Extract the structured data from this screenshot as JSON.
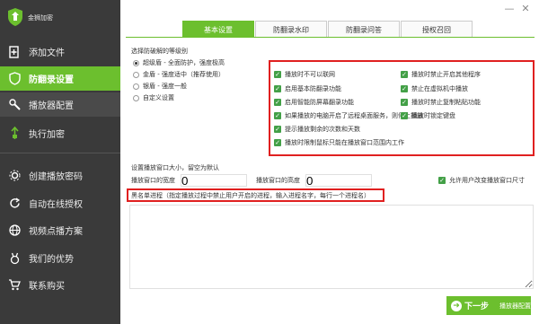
{
  "app": {
    "title": "金狮加密"
  },
  "sidebar": {
    "items": [
      {
        "label": "添加文件",
        "icon": "file-add-icon"
      },
      {
        "label": "防翻录设置",
        "icon": "shield-icon",
        "active": true
      },
      {
        "label": "播放器配置",
        "icon": "wrench-icon"
      },
      {
        "label": "执行加密",
        "icon": "encrypt-icon"
      }
    ],
    "bottom_items": [
      {
        "label": "创建播放密码",
        "icon": "gear-icon"
      },
      {
        "label": "自动在线授权",
        "icon": "refresh-icon"
      },
      {
        "label": "视频点播方案",
        "icon": "globe-icon"
      },
      {
        "label": "我们的优势",
        "icon": "medal-icon"
      },
      {
        "label": "联系购买",
        "icon": "cart-icon"
      }
    ]
  },
  "tabs": [
    {
      "label": "基本设置",
      "active": true
    },
    {
      "label": "防翻录水印"
    },
    {
      "label": "防翻录问答"
    },
    {
      "label": "授权召回"
    }
  ],
  "level": {
    "heading": "选择防破解的等级别",
    "options": [
      {
        "label": "超级盾 - 全面防护，强度极高",
        "selected": true
      },
      {
        "label": "金盾 - 强度适中（推荐使用）",
        "selected": false
      },
      {
        "label": "银盾 - 强度一般",
        "selected": false
      },
      {
        "label": "自定义设置",
        "selected": false
      }
    ]
  },
  "protections": {
    "left": [
      "播放时不可以联网",
      "启用基本防翻录功能",
      "启用智能防屏幕翻录功能",
      "如果播放的电脑开启了远程桌面服务，则停止播放",
      "提示播放剩余的次数和天数",
      "播放时限制鼠标只能在播放窗口范围内工作"
    ],
    "right": [
      "播放时禁止开启其他程序",
      "禁止在虚拟机中播放",
      "播放时禁止复制粘贴功能",
      "播放时锁定键盘"
    ]
  },
  "window_size": {
    "heading": "设置播放窗口大小，留空为默认",
    "width_label": "播放窗口的宽度",
    "height_label": "播放窗口的高度",
    "width_value": "0",
    "height_value": "0",
    "allow_resize_label": "允许用户改变播放窗口尺寸",
    "allow_resize_checked": true
  },
  "blacklist": {
    "label": "黑名单进程（指定播放过程中禁止用户开启的进程，输入进程名字，每行一个进程名）",
    "value": ""
  },
  "footer": {
    "next_label": "下一步",
    "next_sub": "播放器配置"
  },
  "colors": {
    "accent": "#6cbf2e",
    "sidebar": "#3a3a3a",
    "highlight": "#e02020",
    "checkbox": "#43a047"
  }
}
